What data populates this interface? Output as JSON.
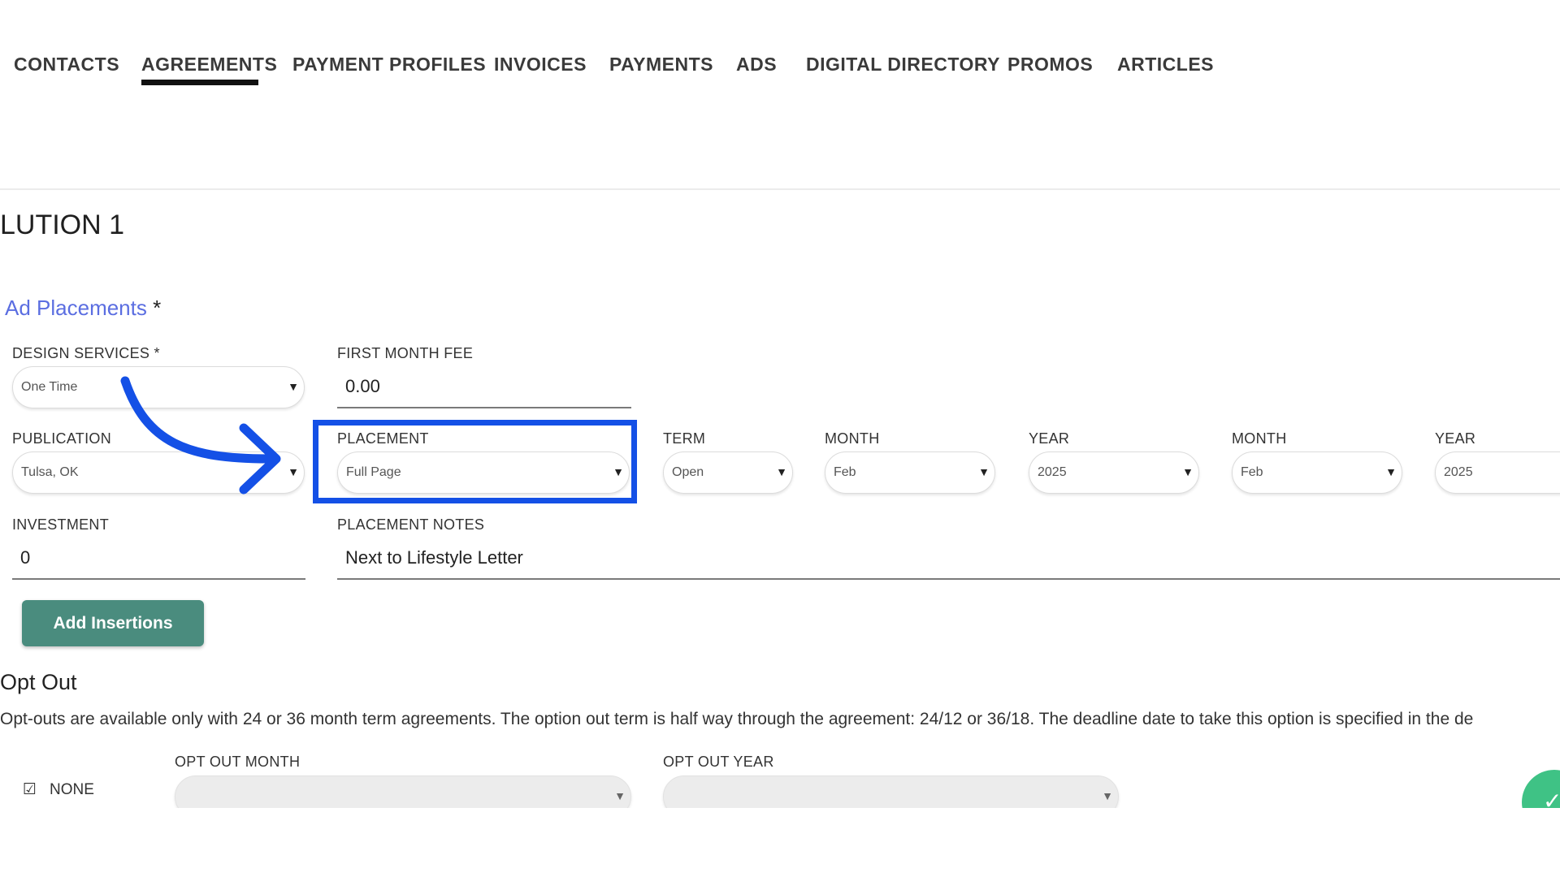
{
  "tabs": [
    {
      "label": "CONTACTS"
    },
    {
      "label": "AGREEMENTS",
      "active": true
    },
    {
      "label": "PAYMENT PROFILES"
    },
    {
      "label": "INVOICES"
    },
    {
      "label": "PAYMENTS"
    },
    {
      "label": "ADS"
    },
    {
      "label": "DIGITAL DIRECTORY"
    },
    {
      "label": "PROMOS"
    },
    {
      "label": "ARTICLES"
    }
  ],
  "page_title": "LUTION 1",
  "ad_placements": {
    "heading": "Ad Placements",
    "required_mark": "*"
  },
  "fields": {
    "design_services": {
      "label": "DESIGN SERVICES *",
      "value": "One Time"
    },
    "first_month_fee": {
      "label": "FIRST MONTH FEE",
      "value": "0.00"
    },
    "publication": {
      "label": "PUBLICATION",
      "value": "Tulsa, OK"
    },
    "placement": {
      "label": "PLACEMENT",
      "value": "Full Page"
    },
    "term": {
      "label": "TERM",
      "value": "Open"
    },
    "start_month": {
      "label": "MONTH",
      "value": "Feb"
    },
    "start_year": {
      "label": "YEAR",
      "value": "2025"
    },
    "end_month": {
      "label": "MONTH",
      "value": "Feb"
    },
    "end_year": {
      "label": "YEAR",
      "value": "2025"
    },
    "investment": {
      "label": "INVESTMENT",
      "value": "0"
    },
    "placement_notes": {
      "label": "PLACEMENT NOTES",
      "value": "Next to Lifestyle Letter"
    }
  },
  "add_insertions_label": "Add Insertions",
  "opt_out": {
    "title": "Opt Out",
    "description": "Opt-outs are available only with 24 or 36 month term agreements. The option out term is half way through the agreement: 24/12 or 36/18. The deadline date to take this option is specified in the de",
    "none_label": "NONE",
    "month_label": "OPT OUT MONTH",
    "year_label": "OPT OUT YEAR"
  },
  "icons": {
    "dropdown": "caret-down-icon",
    "checkbox": "checked-checkbox-icon",
    "confirm": "checkmark-icon"
  },
  "colors": {
    "link": "#5b6ee1",
    "primary_button": "#4a8c7e",
    "highlight": "#1450e6",
    "confirm_button": "#3fc285"
  }
}
